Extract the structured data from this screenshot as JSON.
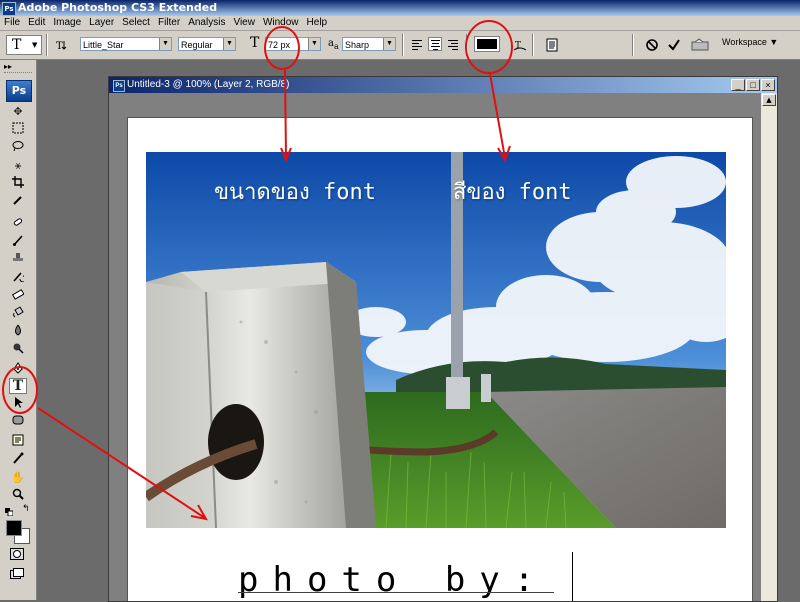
{
  "app": {
    "title": "Adobe Photoshop CS3 Extended",
    "ps_mini": "Ps"
  },
  "menu": [
    "File",
    "Edit",
    "Image",
    "Layer",
    "Select",
    "Filter",
    "Analysis",
    "View",
    "Window",
    "Help"
  ],
  "options": {
    "tool_letter": "T",
    "font_family": "Little_Star",
    "font_style": "Regular",
    "size_prefix": "T",
    "font_size": "72 px",
    "aa_prefix": "a",
    "antialias": "Sharp",
    "text_color": "#000000",
    "workspace_label": "Workspace"
  },
  "tools_logo": "Ps",
  "document": {
    "title": "Untitled-3 @ 100% (Layer 2, RGB/8)",
    "annotation_font_size": "ขนาดของ font",
    "annotation_font_color": "สีของ font",
    "caption": "photo by:"
  },
  "colors": {
    "title_start": "#0a246a",
    "title_end": "#a6caf0",
    "chrome": "#d4d0c8",
    "annotation_red": "#e01010",
    "foreground": "#000000",
    "background": "#ffffff"
  }
}
